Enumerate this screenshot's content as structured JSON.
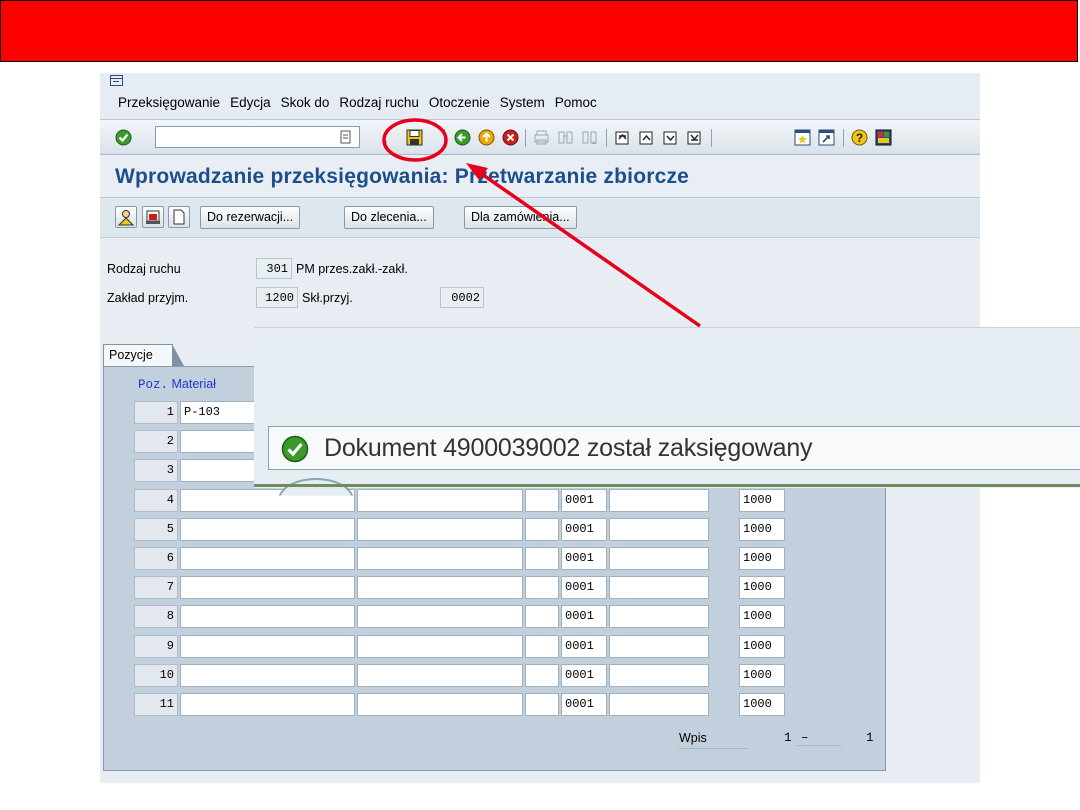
{
  "menu": {
    "items": [
      "Przeksięgowanie",
      "Edycja",
      "Skok do",
      "Rodzaj ruchu",
      "Otoczenie",
      "System",
      "Pomoc"
    ]
  },
  "toolbar": {
    "command_value": "",
    "icons": [
      "enter-icon",
      "save-icon",
      "back-icon",
      "exit-icon",
      "cancel-icon",
      "print-icon",
      "find-icon",
      "find-next-icon",
      "first-page-icon",
      "previous-page-icon",
      "next-page-icon",
      "last-page-icon",
      "new-session-icon",
      "shortcut-icon",
      "help-icon",
      "layout-icon"
    ]
  },
  "page": {
    "title": "Wprowadzanie przeksięgowania: Przetwarzanie zbiorcze"
  },
  "app_toolbar": {
    "buttons": [
      "Do rezerwacji...",
      "Do zlecenia...",
      "Dla zamówienia..."
    ]
  },
  "header": {
    "movement_type_label": "Rodzaj ruchu",
    "movement_type_code": "301",
    "movement_type_text": "PM przes.zakł.-zakł.",
    "plant_label": "Zakład przyjm.",
    "plant_value": "1200",
    "storage_label": "Skł.przyj.",
    "storage_value": "0002"
  },
  "items": {
    "tab_label": "Pozycje",
    "col_poz": "Poz.",
    "col_material": "Materiał",
    "rows": [
      {
        "poz": "1",
        "material": "P-103",
        "sloc": "",
        "plant": ""
      },
      {
        "poz": "2",
        "material": "",
        "sloc": "",
        "plant": ""
      },
      {
        "poz": "3",
        "material": "",
        "sloc": "",
        "plant": ""
      },
      {
        "poz": "4",
        "material": "",
        "sloc": "0001",
        "plant": "1000"
      },
      {
        "poz": "5",
        "material": "",
        "sloc": "0001",
        "plant": "1000"
      },
      {
        "poz": "6",
        "material": "",
        "sloc": "0001",
        "plant": "1000"
      },
      {
        "poz": "7",
        "material": "",
        "sloc": "0001",
        "plant": "1000"
      },
      {
        "poz": "8",
        "material": "",
        "sloc": "0001",
        "plant": "1000"
      },
      {
        "poz": "9",
        "material": "",
        "sloc": "0001",
        "plant": "1000"
      },
      {
        "poz": "10",
        "material": "",
        "sloc": "0001",
        "plant": "1000"
      },
      {
        "poz": "11",
        "material": "",
        "sloc": "0001",
        "plant": "1000"
      }
    ],
    "wpis_label": "Wpis",
    "wpis_from": "1",
    "wpis_dash": "–",
    "wpis_total": "1"
  },
  "status": {
    "message": "Dokument 4900039002 został zaksięgowany"
  },
  "colors": {
    "banner": "#ff0000",
    "annotation": "#e8001a",
    "title": "#1d4f8a",
    "success": "#3a9a2a"
  }
}
